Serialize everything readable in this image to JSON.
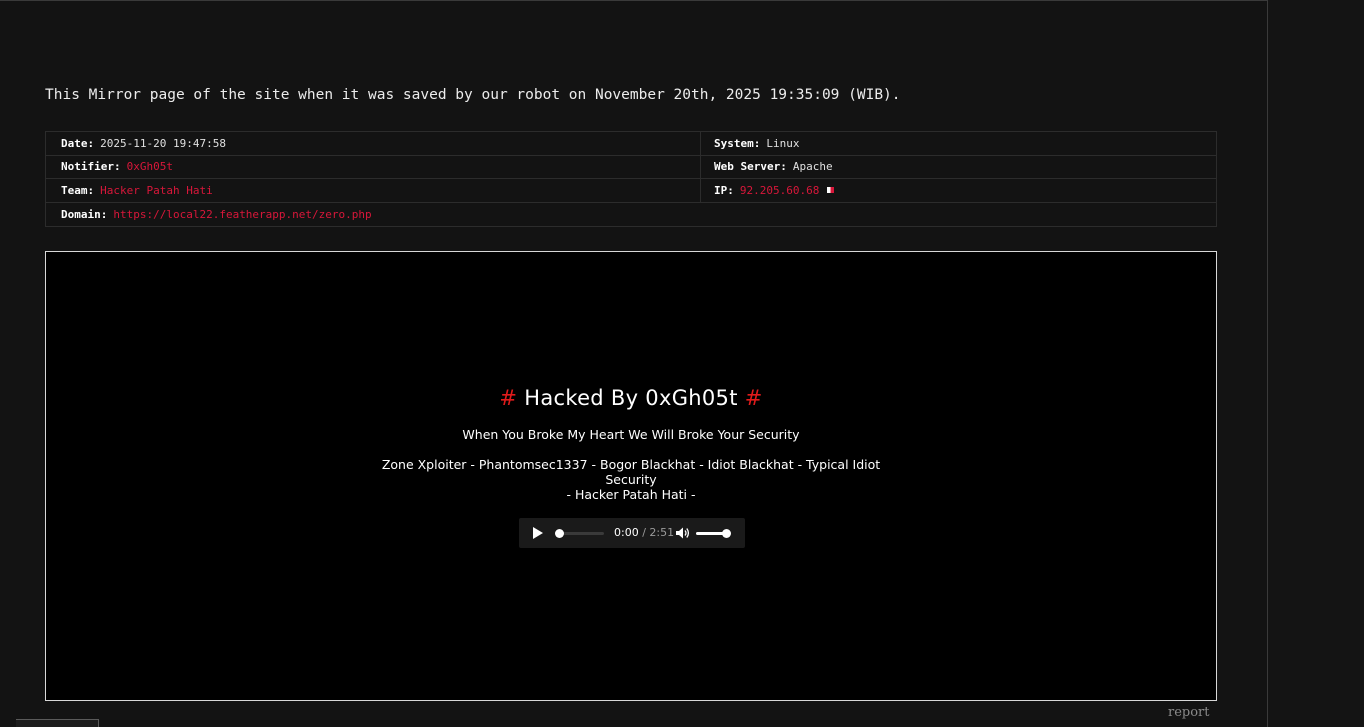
{
  "intro_text": "This Mirror page of the site when it was saved by our robot on November 20th, 2025 19:35:09 (WIB).",
  "info": {
    "date_label": "Date:",
    "date_value": "2025-11-20 19:47:58",
    "system_label": "System:",
    "system_value": "Linux",
    "notifier_label": "Notifier:",
    "notifier_value": "0xGh05t",
    "webserver_label": "Web Server:",
    "webserver_value": "Apache",
    "team_label": "Team:",
    "team_value": "Hacker Patah Hati",
    "ip_label": "IP:",
    "ip_value": "92.205.60.68",
    "domain_label": "Domain:",
    "domain_value": "https://local22.featherapp.net/zero.php"
  },
  "mirror": {
    "hash_left": "#",
    "title": "Hacked By 0xGh05t",
    "hash_right": "#",
    "subtitle": "When You Broke My Heart We Will Broke Your Security",
    "crews": "Zone Xploiter - Phantomsec1337 - Bogor Blackhat - Idiot Blackhat - Typical Idiot Security",
    "team_line": "- Hacker Patah Hati -"
  },
  "audio": {
    "current_time": "0:00",
    "separator": " / ",
    "duration": "2:51",
    "progress": 0,
    "volume": 1
  },
  "report_link": "report",
  "colors": {
    "accent_red": "#d8173a",
    "hash_red": "#e01b1b"
  }
}
